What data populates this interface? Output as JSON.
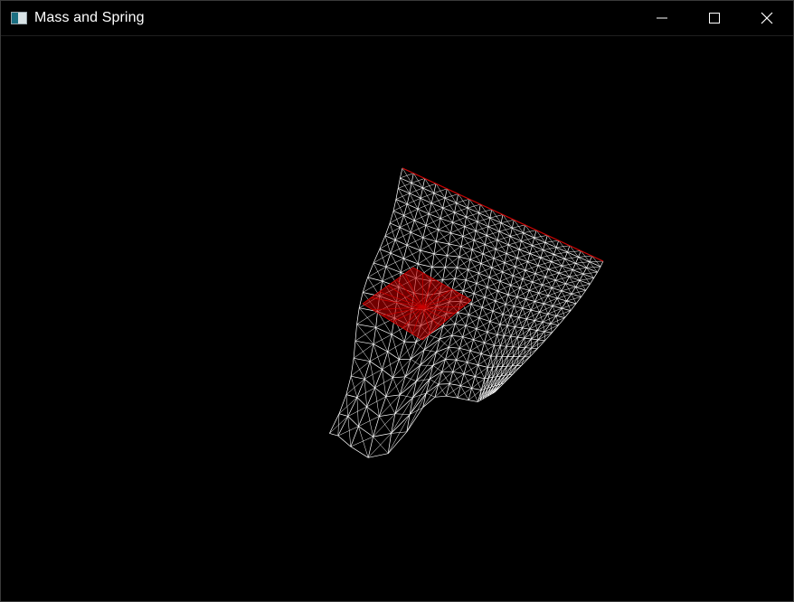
{
  "window": {
    "title": "Mass and Spring",
    "icon": "app-window-icon",
    "controls": {
      "minimize_icon": "minimize-icon",
      "maximize_icon": "maximize-icon",
      "close_icon": "close-icon"
    }
  },
  "scene": {
    "background": "#000000",
    "mesh_color": "#ffffff",
    "highlight_color": "#cc0000"
  }
}
